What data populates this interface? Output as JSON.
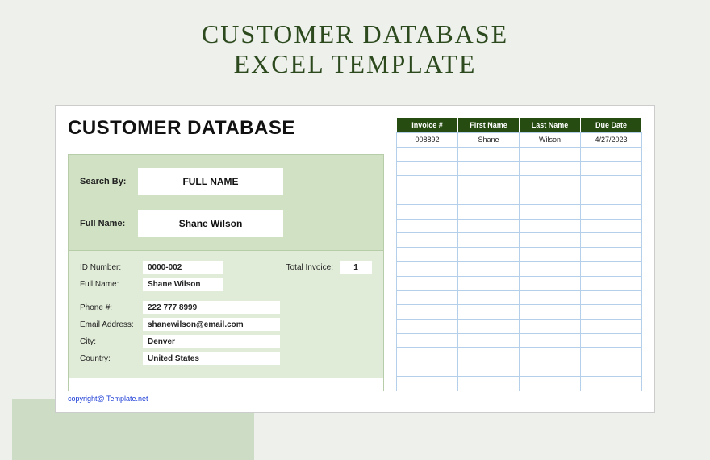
{
  "page": {
    "title_line1": "CUSTOMER DATABASE",
    "title_line2": "EXCEL TEMPLATE"
  },
  "sheet": {
    "heading": "CUSTOMER DATABASE",
    "search": {
      "label": "Search By:",
      "value": "FULL NAME"
    },
    "fullname": {
      "label": "Full Name:",
      "value": "Shane Wilson"
    },
    "details": {
      "id_label": "ID Number:",
      "id_value": "0000-002",
      "total_invoice_label": "Total Invoice:",
      "total_invoice_value": "1",
      "fullname_label": "Full Name:",
      "fullname_value": "Shane Wilson",
      "phone_label": "Phone #:",
      "phone_value": "222 777 8999",
      "email_label": "Email Address:",
      "email_value": "shanewilson@email.com",
      "city_label": "City:",
      "city_value": "Denver",
      "country_label": "Country:",
      "country_value": "United States"
    },
    "table": {
      "headers": [
        "Invoice #",
        "First Name",
        "Last Name",
        "Due Date"
      ],
      "rows": [
        [
          "008892",
          "Shane",
          "Wilson",
          "4/27/2023"
        ]
      ]
    },
    "copyright": "copyright@ Template.net"
  }
}
